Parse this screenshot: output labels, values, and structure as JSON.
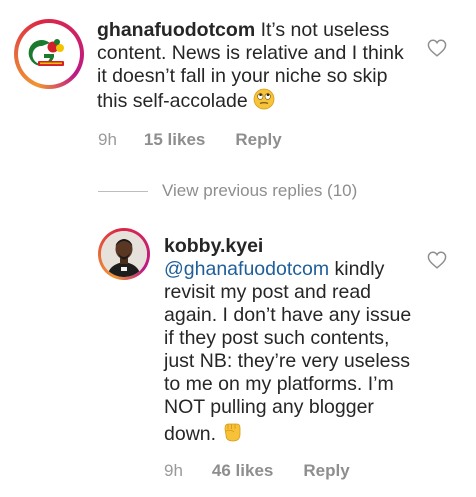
{
  "comments": [
    {
      "username": "ghanafuodotcom",
      "text": "It’s not useless content. News is relative and I think it doesn’t fall in your niche so skip this self-accolade",
      "emoji": "eye-roll-emoji",
      "time": "9h",
      "likes": "15 likes",
      "reply": "Reply"
    },
    {
      "username": "kobby.kyei",
      "mention": "@ghanafuodotcom",
      "text": "kindly revisit my post and read again. I don’t have any issue if they post such contents, just NB: they’re very useless to me on my platforms. I’m NOT pulling any blogger down.",
      "emoji": "raised-fist-emoji",
      "time": "9h",
      "likes": "46 likes",
      "reply": "Reply"
    }
  ],
  "view_replies": "View previous replies (10)",
  "colors": {
    "text": "#262626",
    "meta": "#8e8e8e",
    "mention": "#1f5f99",
    "ring_gradient": [
      "#f09433",
      "#dc2743",
      "#bc1888"
    ]
  },
  "icons": [
    "heart-outline-icon"
  ]
}
